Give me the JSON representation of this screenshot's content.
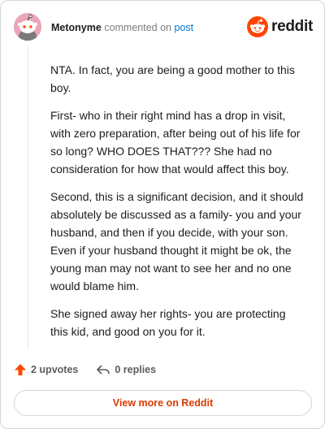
{
  "comment": {
    "username": "Metonyme",
    "action_text": "commented on",
    "post_link": "post",
    "paragraphs": [
      "NTA. In fact, you are being a good mother to this boy.",
      "First- who in their right mind has a drop in visit, with zero preparation, after being out of his life for so long? WHO DOES THAT??? She had no consideration for how that would affect this boy.",
      "Second, this is a significant decision, and it should absolutely be discussed as a family- you and your husband, and then if you decide, with your son. Even if your husband thought it might be ok, the young man may not want to see her and no one would blame him.",
      "She signed away her rights- you are protecting this kid, and good on you for it."
    ]
  },
  "logo": {
    "wordmark": "reddit",
    "icon": "reddit-snoo-icon"
  },
  "actions": {
    "upvotes": "2 upvotes",
    "replies": "0 replies"
  },
  "view_more_label": "View more on Reddit",
  "colors": {
    "brand": "#ff4500",
    "link": "#0079d3",
    "cta_text": "#d93a00",
    "avatar_bg": "#e9a6b8"
  }
}
